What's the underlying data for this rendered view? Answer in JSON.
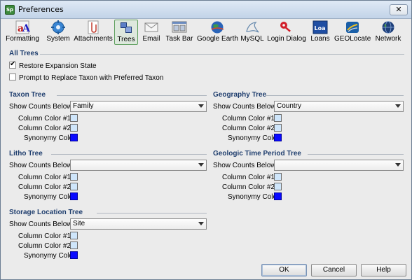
{
  "window": {
    "title": "Preferences",
    "close_symbol": "✕"
  },
  "toolbar": {
    "items": [
      {
        "label": "Formatting"
      },
      {
        "label": "System"
      },
      {
        "label": "Attachments"
      },
      {
        "label": "Trees"
      },
      {
        "label": "Email"
      },
      {
        "label": "Task Bar"
      },
      {
        "label": "Google Earth"
      },
      {
        "label": "MySQL"
      },
      {
        "label": "Login Dialog"
      },
      {
        "label": "Loans",
        "icon_text": "Loa"
      },
      {
        "label": "GEOLocate"
      },
      {
        "label": "Network"
      }
    ],
    "selected": "Trees"
  },
  "all_trees": {
    "title": "All Trees",
    "restore_label": "Restore Expansion State",
    "restore_checked": true,
    "prompt_label": "Prompt to Replace Taxon with Preferred Taxon",
    "prompt_checked": false
  },
  "labels": {
    "show_counts": "Show Counts Below:",
    "col1": "Column Color #1:",
    "col2": "Column Color #2:",
    "synonymy": "Synonymy Color:"
  },
  "taxon": {
    "title": "Taxon Tree",
    "value": "Family"
  },
  "geography": {
    "title": "Geography Tree",
    "value": "Country"
  },
  "litho": {
    "title": "Litho Tree",
    "value": ""
  },
  "geologic": {
    "title": "Geologic Time Period Tree",
    "value": ""
  },
  "storage": {
    "title": "Storage Location Tree",
    "value": "Site"
  },
  "colors": {
    "column": "#cfe6fb",
    "synonymy": "#0a0aff",
    "section_title": "#1f3e6e"
  },
  "buttons": {
    "ok": "OK",
    "cancel": "Cancel",
    "help": "Help"
  }
}
